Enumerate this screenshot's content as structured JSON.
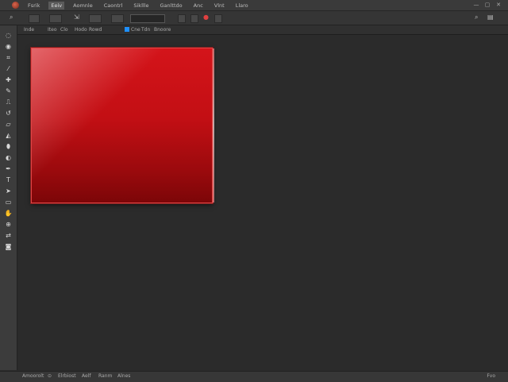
{
  "menubar": {
    "items": [
      "Fsrik",
      "Eeiv",
      "Aomnle",
      "Caontrl",
      "Sikllle",
      "Ganlttdo",
      "Anc",
      "Vlnt",
      "Llaro"
    ],
    "active_index": 1,
    "window_controls": [
      "—",
      "▢",
      "✕"
    ]
  },
  "options_bar": {
    "tool_icon": "move-icon"
  },
  "document_tabs": {
    "items": [
      "Inde",
      "Iteo",
      "Clo",
      "Hodo",
      "Rowd",
      "Cne",
      "Tdn",
      "Bnoore"
    ],
    "swatch_colors": [
      "#1e90ff",
      "#4aa3df"
    ]
  },
  "toolbar": {
    "tools": [
      {
        "name": "lasso-tool-icon",
        "glyph": "◌"
      },
      {
        "name": "quick-select-icon",
        "glyph": "◉"
      },
      {
        "name": "crop-icon",
        "glyph": "⌗"
      },
      {
        "name": "eyedropper-icon",
        "glyph": "⁄"
      },
      {
        "name": "spot-heal-icon",
        "glyph": "✚"
      },
      {
        "name": "brush-icon",
        "glyph": "✎"
      },
      {
        "name": "stamp-icon",
        "glyph": "⎍"
      },
      {
        "name": "history-brush-icon",
        "glyph": "↺"
      },
      {
        "name": "eraser-icon",
        "glyph": "▱"
      },
      {
        "name": "bucket-icon",
        "glyph": "◭"
      },
      {
        "name": "blur-icon",
        "glyph": "⬮"
      },
      {
        "name": "dodge-icon",
        "glyph": "◐"
      },
      {
        "name": "pen-icon",
        "glyph": "✒"
      },
      {
        "name": "type-icon",
        "glyph": "T"
      },
      {
        "name": "path-select-icon",
        "glyph": "➤"
      },
      {
        "name": "shape-icon",
        "glyph": "▭"
      },
      {
        "name": "hand-icon",
        "glyph": "✋"
      },
      {
        "name": "zoom-icon",
        "glyph": "⊕"
      },
      {
        "name": "color-swap-icon",
        "glyph": "⇄"
      },
      {
        "name": "quick-mask-icon",
        "glyph": "◙"
      }
    ]
  },
  "canvas": {
    "artwork_color": "#c30f14"
  },
  "statusbar": {
    "items": [
      "Amoorolt",
      "⊙",
      "Elrbiost",
      "Aelf",
      "Ranm",
      "Alnes"
    ],
    "right": "Fvo"
  }
}
